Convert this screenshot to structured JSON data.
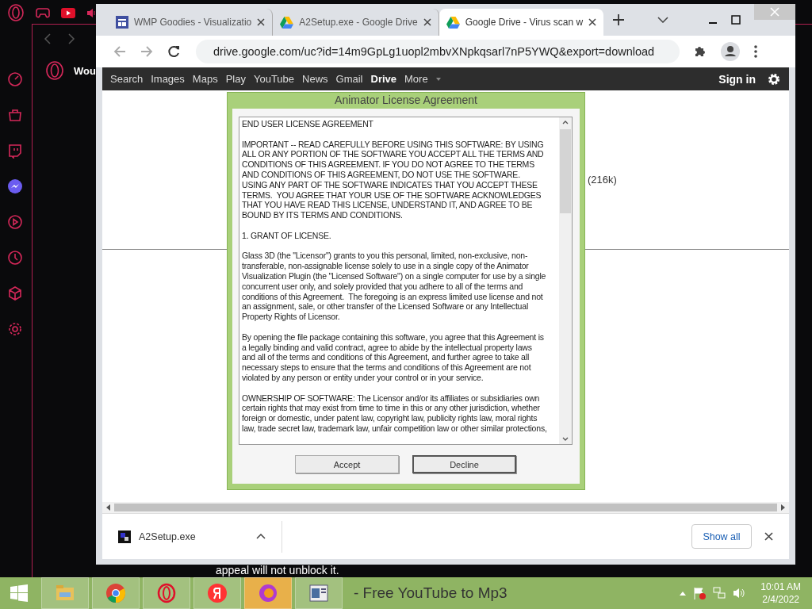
{
  "opera": {
    "tab_title": "Wou"
  },
  "browser": {
    "tabs": [
      {
        "title": "WMP Goodies - Visualizatio",
        "kind": "layout",
        "selected": false
      },
      {
        "title": "A2Setup.exe - Google Drive",
        "kind": "drive",
        "selected": false
      },
      {
        "title": "Google Drive - Virus scan w",
        "kind": "drive",
        "selected": true
      }
    ],
    "url": "drive.google.com/uc?id=14m9GpLg1uopl2mbvXNpkqsarl7nP5YWQ&export=download"
  },
  "google_bar": {
    "links": [
      {
        "label": "Search",
        "selected": false
      },
      {
        "label": "Images",
        "selected": false
      },
      {
        "label": "Maps",
        "selected": false
      },
      {
        "label": "Play",
        "selected": false
      },
      {
        "label": "YouTube",
        "selected": false
      },
      {
        "label": "News",
        "selected": false
      },
      {
        "label": "Gmail",
        "selected": false
      },
      {
        "label": "Drive",
        "selected": true
      },
      {
        "label": "More",
        "selected": false
      }
    ],
    "sign_in": "Sign in"
  },
  "page": {
    "file_size": "(216k)"
  },
  "dialog": {
    "title": "Animator License Agreement",
    "paragraphs": [
      {
        "lines": [
          "END USER LICENSE AGREEMENT"
        ]
      },
      {
        "lines": [
          "IMPORTANT -- READ CAREFULLY BEFORE USING THIS SOFTWARE: BY USING",
          "ALL OR ANY PORTION OF THE SOFTWARE YOU ACCEPT ALL THE TERMS AND",
          "CONDITIONS OF THIS AGREEMENT. IF YOU DO NOT AGREE TO THE TERMS",
          "AND CONDITIONS OF THIS AGREEMENT, DO NOT USE THE SOFTWARE.",
          "USING ANY PART OF THE SOFTWARE INDICATES THAT YOU ACCEPT THESE",
          "TERMS.  YOU AGREE THAT YOUR USE OF THE SOFTWARE ACKNOWLEDGES",
          "THAT YOU HAVE READ THIS LICENSE, UNDERSTAND IT, AND AGREE TO BE",
          "BOUND BY ITS TERMS AND CONDITIONS."
        ]
      },
      {
        "lines": [
          "1. GRANT OF LICENSE."
        ]
      },
      {
        "lines": [
          "Glass 3D (the \"Licensor\") grants to you this personal, limited, non-exclusive, non-",
          "transferable, non-assignable license solely to use in a single copy of the Animator",
          "Visualization Plugin (the \"Licensed Software\") on a single computer for use by a single",
          "concurrent user only, and solely provided that you adhere to all of the terms and",
          "conditions of this Agreement.  The foregoing is an express limited use license and not",
          "an assignment, sale, or other transfer of the Licensed Software or any Intellectual",
          "Property Rights of Licensor."
        ]
      },
      {
        "lines": [
          "By opening the file package containing this software, you agree that this Agreement is",
          "a legally binding and valid contract, agree to abide by the intellectual property laws",
          "and all of the terms and conditions of this Agreement, and further agree to take all",
          "necessary steps to ensure that the terms and conditions of this Agreement are not",
          "violated by any person or entity under your control or in your service."
        ]
      },
      {
        "lines": [
          "OWNERSHIP OF SOFTWARE: The Licensor and/or its affiliates or subsidiaries own",
          "certain rights that may exist from time to time in this or any other jurisdiction, whether",
          "foreign or domestic, under patent law, copyright law, publicity rights law, moral rights",
          "law, trade secret law, trademark law, unfair competition law or other similar protections,"
        ]
      }
    ],
    "buttons": [
      {
        "label": "Accept",
        "default": false
      },
      {
        "label": "Decline",
        "default": true
      }
    ]
  },
  "downloads": {
    "file": "A2Setup.exe",
    "show_all": "Show all"
  },
  "caption": "appeal will not unblock it.",
  "taskbar": {
    "ghost_title": "- Free YouTube to Mp3",
    "time": "10:01 AM",
    "date": "2/4/2022"
  }
}
